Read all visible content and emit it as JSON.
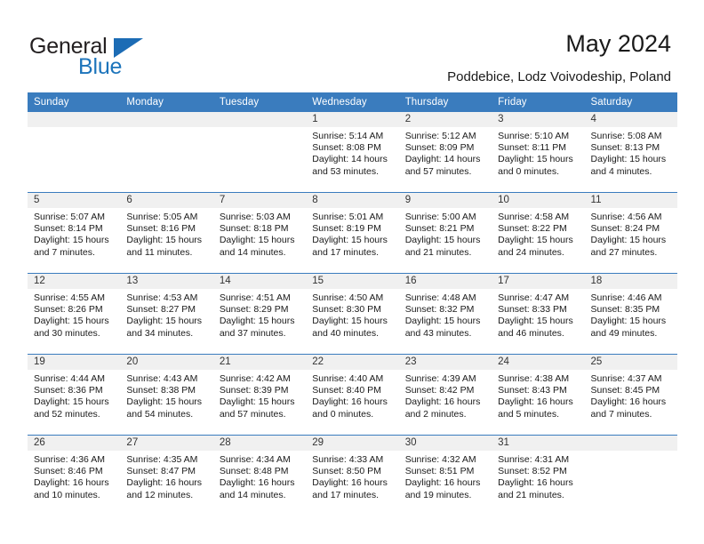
{
  "brand": {
    "name_top": "General",
    "name_bottom": "Blue",
    "color_dark": "#231f20",
    "color_blue": "#1c74bb"
  },
  "header": {
    "title": "May 2024",
    "subtitle": "Poddebice, Lodz Voivodeship, Poland"
  },
  "theme": {
    "header_bg": "#3a7cbe",
    "date_band_bg": "#f0f0f0",
    "row_rule": "#3a7cbe"
  },
  "calendar": {
    "weekday_headers": [
      "Sunday",
      "Monday",
      "Tuesday",
      "Wednesday",
      "Thursday",
      "Friday",
      "Saturday"
    ],
    "weeks": [
      [
        {
          "day": "",
          "empty": true
        },
        {
          "day": "",
          "empty": true
        },
        {
          "day": "",
          "empty": true
        },
        {
          "day": "1",
          "sunrise": "Sunrise: 5:14 AM",
          "sunset": "Sunset: 8:08 PM",
          "daylight_1": "Daylight: 14 hours",
          "daylight_2": "and 53 minutes."
        },
        {
          "day": "2",
          "sunrise": "Sunrise: 5:12 AM",
          "sunset": "Sunset: 8:09 PM",
          "daylight_1": "Daylight: 14 hours",
          "daylight_2": "and 57 minutes."
        },
        {
          "day": "3",
          "sunrise": "Sunrise: 5:10 AM",
          "sunset": "Sunset: 8:11 PM",
          "daylight_1": "Daylight: 15 hours",
          "daylight_2": "and 0 minutes."
        },
        {
          "day": "4",
          "sunrise": "Sunrise: 5:08 AM",
          "sunset": "Sunset: 8:13 PM",
          "daylight_1": "Daylight: 15 hours",
          "daylight_2": "and 4 minutes."
        }
      ],
      [
        {
          "day": "5",
          "sunrise": "Sunrise: 5:07 AM",
          "sunset": "Sunset: 8:14 PM",
          "daylight_1": "Daylight: 15 hours",
          "daylight_2": "and 7 minutes."
        },
        {
          "day": "6",
          "sunrise": "Sunrise: 5:05 AM",
          "sunset": "Sunset: 8:16 PM",
          "daylight_1": "Daylight: 15 hours",
          "daylight_2": "and 11 minutes."
        },
        {
          "day": "7",
          "sunrise": "Sunrise: 5:03 AM",
          "sunset": "Sunset: 8:18 PM",
          "daylight_1": "Daylight: 15 hours",
          "daylight_2": "and 14 minutes."
        },
        {
          "day": "8",
          "sunrise": "Sunrise: 5:01 AM",
          "sunset": "Sunset: 8:19 PM",
          "daylight_1": "Daylight: 15 hours",
          "daylight_2": "and 17 minutes."
        },
        {
          "day": "9",
          "sunrise": "Sunrise: 5:00 AM",
          "sunset": "Sunset: 8:21 PM",
          "daylight_1": "Daylight: 15 hours",
          "daylight_2": "and 21 minutes."
        },
        {
          "day": "10",
          "sunrise": "Sunrise: 4:58 AM",
          "sunset": "Sunset: 8:22 PM",
          "daylight_1": "Daylight: 15 hours",
          "daylight_2": "and 24 minutes."
        },
        {
          "day": "11",
          "sunrise": "Sunrise: 4:56 AM",
          "sunset": "Sunset: 8:24 PM",
          "daylight_1": "Daylight: 15 hours",
          "daylight_2": "and 27 minutes."
        }
      ],
      [
        {
          "day": "12",
          "sunrise": "Sunrise: 4:55 AM",
          "sunset": "Sunset: 8:26 PM",
          "daylight_1": "Daylight: 15 hours",
          "daylight_2": "and 30 minutes."
        },
        {
          "day": "13",
          "sunrise": "Sunrise: 4:53 AM",
          "sunset": "Sunset: 8:27 PM",
          "daylight_1": "Daylight: 15 hours",
          "daylight_2": "and 34 minutes."
        },
        {
          "day": "14",
          "sunrise": "Sunrise: 4:51 AM",
          "sunset": "Sunset: 8:29 PM",
          "daylight_1": "Daylight: 15 hours",
          "daylight_2": "and 37 minutes."
        },
        {
          "day": "15",
          "sunrise": "Sunrise: 4:50 AM",
          "sunset": "Sunset: 8:30 PM",
          "daylight_1": "Daylight: 15 hours",
          "daylight_2": "and 40 minutes."
        },
        {
          "day": "16",
          "sunrise": "Sunrise: 4:48 AM",
          "sunset": "Sunset: 8:32 PM",
          "daylight_1": "Daylight: 15 hours",
          "daylight_2": "and 43 minutes."
        },
        {
          "day": "17",
          "sunrise": "Sunrise: 4:47 AM",
          "sunset": "Sunset: 8:33 PM",
          "daylight_1": "Daylight: 15 hours",
          "daylight_2": "and 46 minutes."
        },
        {
          "day": "18",
          "sunrise": "Sunrise: 4:46 AM",
          "sunset": "Sunset: 8:35 PM",
          "daylight_1": "Daylight: 15 hours",
          "daylight_2": "and 49 minutes."
        }
      ],
      [
        {
          "day": "19",
          "sunrise": "Sunrise: 4:44 AM",
          "sunset": "Sunset: 8:36 PM",
          "daylight_1": "Daylight: 15 hours",
          "daylight_2": "and 52 minutes."
        },
        {
          "day": "20",
          "sunrise": "Sunrise: 4:43 AM",
          "sunset": "Sunset: 8:38 PM",
          "daylight_1": "Daylight: 15 hours",
          "daylight_2": "and 54 minutes."
        },
        {
          "day": "21",
          "sunrise": "Sunrise: 4:42 AM",
          "sunset": "Sunset: 8:39 PM",
          "daylight_1": "Daylight: 15 hours",
          "daylight_2": "and 57 minutes."
        },
        {
          "day": "22",
          "sunrise": "Sunrise: 4:40 AM",
          "sunset": "Sunset: 8:40 PM",
          "daylight_1": "Daylight: 16 hours",
          "daylight_2": "and 0 minutes."
        },
        {
          "day": "23",
          "sunrise": "Sunrise: 4:39 AM",
          "sunset": "Sunset: 8:42 PM",
          "daylight_1": "Daylight: 16 hours",
          "daylight_2": "and 2 minutes."
        },
        {
          "day": "24",
          "sunrise": "Sunrise: 4:38 AM",
          "sunset": "Sunset: 8:43 PM",
          "daylight_1": "Daylight: 16 hours",
          "daylight_2": "and 5 minutes."
        },
        {
          "day": "25",
          "sunrise": "Sunrise: 4:37 AM",
          "sunset": "Sunset: 8:45 PM",
          "daylight_1": "Daylight: 16 hours",
          "daylight_2": "and 7 minutes."
        }
      ],
      [
        {
          "day": "26",
          "sunrise": "Sunrise: 4:36 AM",
          "sunset": "Sunset: 8:46 PM",
          "daylight_1": "Daylight: 16 hours",
          "daylight_2": "and 10 minutes."
        },
        {
          "day": "27",
          "sunrise": "Sunrise: 4:35 AM",
          "sunset": "Sunset: 8:47 PM",
          "daylight_1": "Daylight: 16 hours",
          "daylight_2": "and 12 minutes."
        },
        {
          "day": "28",
          "sunrise": "Sunrise: 4:34 AM",
          "sunset": "Sunset: 8:48 PM",
          "daylight_1": "Daylight: 16 hours",
          "daylight_2": "and 14 minutes."
        },
        {
          "day": "29",
          "sunrise": "Sunrise: 4:33 AM",
          "sunset": "Sunset: 8:50 PM",
          "daylight_1": "Daylight: 16 hours",
          "daylight_2": "and 17 minutes."
        },
        {
          "day": "30",
          "sunrise": "Sunrise: 4:32 AM",
          "sunset": "Sunset: 8:51 PM",
          "daylight_1": "Daylight: 16 hours",
          "daylight_2": "and 19 minutes."
        },
        {
          "day": "31",
          "sunrise": "Sunrise: 4:31 AM",
          "sunset": "Sunset: 8:52 PM",
          "daylight_1": "Daylight: 16 hours",
          "daylight_2": "and 21 minutes."
        },
        {
          "day": "",
          "empty": true
        }
      ]
    ]
  }
}
